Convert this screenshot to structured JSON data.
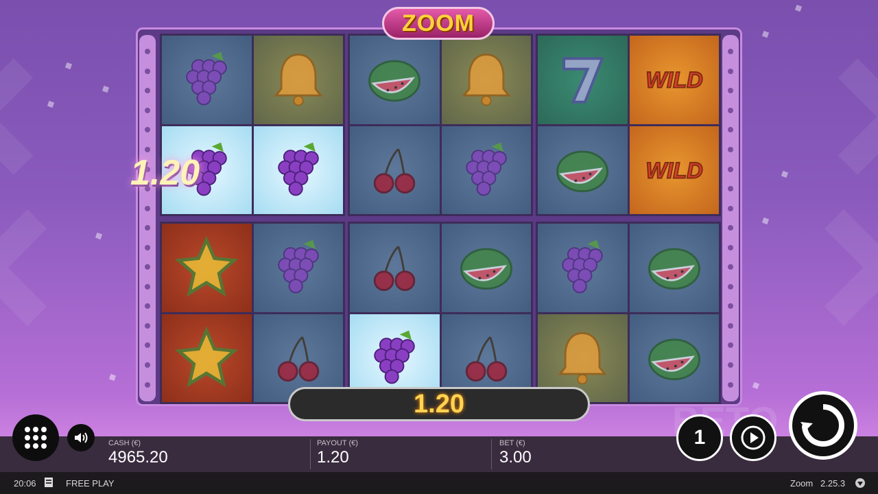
{
  "game": {
    "logo_text": "ZOOM",
    "win_popup": "1.20",
    "win_bar_value": "1.20",
    "watermark": "BETO"
  },
  "colors": {
    "accent": "#ffd452",
    "frame": "#c98be0",
    "bg_top": "#7a4fae",
    "bg_bottom": "#e99bf0"
  },
  "reels": [
    {
      "cells": [
        {
          "symbol": "grape",
          "bg": "blue"
        },
        {
          "symbol": "bell",
          "bg": "gold"
        },
        {
          "symbol": "grape",
          "bg": "ice",
          "win": true
        },
        {
          "symbol": "grape",
          "bg": "ice",
          "win": true
        }
      ]
    },
    {
      "cells": [
        {
          "symbol": "watermelon",
          "bg": "blue"
        },
        {
          "symbol": "bell",
          "bg": "gold"
        },
        {
          "symbol": "cherry",
          "bg": "blue"
        },
        {
          "symbol": "grape",
          "bg": "blue"
        }
      ]
    },
    {
      "cells": [
        {
          "symbol": "seven",
          "bg": "green"
        },
        {
          "symbol": "wild",
          "bg": "orange"
        },
        {
          "symbol": "watermelon",
          "bg": "blue"
        },
        {
          "symbol": "wild",
          "bg": "orange"
        }
      ]
    },
    {
      "cells": [
        {
          "symbol": "star",
          "bg": "red"
        },
        {
          "symbol": "grape",
          "bg": "blue"
        },
        {
          "symbol": "star",
          "bg": "red"
        },
        {
          "symbol": "cherry",
          "bg": "blue"
        }
      ]
    },
    {
      "cells": [
        {
          "symbol": "cherry",
          "bg": "blue"
        },
        {
          "symbol": "watermelon",
          "bg": "blue"
        },
        {
          "symbol": "grape",
          "bg": "ice",
          "win": true
        },
        {
          "symbol": "cherry",
          "bg": "blue"
        }
      ]
    },
    {
      "cells": [
        {
          "symbol": "grape",
          "bg": "blue"
        },
        {
          "symbol": "watermelon",
          "bg": "blue"
        },
        {
          "symbol": "bell",
          "bg": "gold"
        },
        {
          "symbol": "watermelon",
          "bg": "blue"
        }
      ]
    }
  ],
  "info": {
    "cash_label": "CASH (€)",
    "cash_value": "4965.20",
    "payout_label": "PAYOUT (€)",
    "payout_value": "1.20",
    "bet_label": "BET (€)",
    "bet_value": "3.00"
  },
  "controls": {
    "bet_level": "1",
    "menu_icon": "grid-icon",
    "sound_icon": "speaker-icon",
    "autoplay_icon": "play-icon",
    "spin_icon": "spin-icon"
  },
  "status": {
    "time": "20:06",
    "mode": "FREE PLAY",
    "game_name": "Zoom",
    "version": "2.25.3"
  }
}
